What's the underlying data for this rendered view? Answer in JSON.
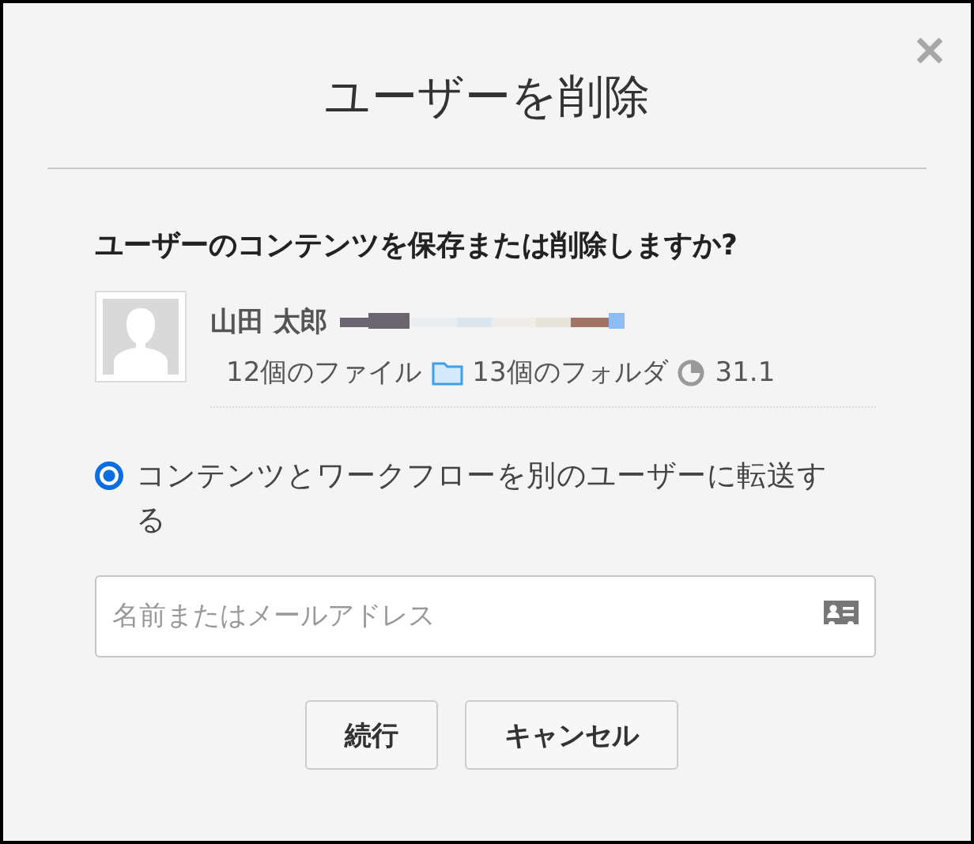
{
  "dialog": {
    "title": "ユーザーを削除",
    "question": "ユーザーのコンテンツを保存または削除しますか?",
    "user": {
      "name": "山田 太郎",
      "files": "12個のファイル",
      "folders": "13個のフォルダ",
      "storage": "31.1"
    },
    "options": [
      {
        "label": "コンテンツとワークフローを別のユーザーに転送する",
        "selected": true
      }
    ],
    "recipient": {
      "placeholder": "名前またはメールアドレス"
    },
    "buttons": [
      "続行",
      "キャンセル"
    ]
  }
}
